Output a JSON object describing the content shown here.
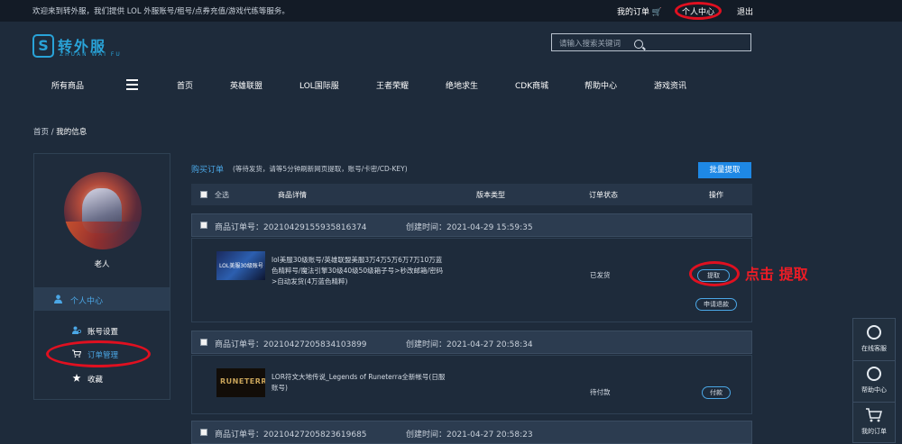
{
  "topbar": {
    "welcome": "欢迎来到转外服，我们提供 LOL 外服账号/租号/点券充值/游戏代练等服务。",
    "my_orders": "我的订单 🛒",
    "personal_center": "个人中心",
    "logout": "退出"
  },
  "logo": {
    "mark": "S",
    "name": "转外服",
    "pinyin": "ZHUAN WAI FU"
  },
  "search": {
    "placeholder": "请输入搜索关键词"
  },
  "nav": {
    "items": [
      "所有商品",
      "首页",
      "英雄联盟",
      "LOL国际服",
      "王者荣耀",
      "绝地求生",
      "CDK商城",
      "帮助中心",
      "游戏资讯"
    ]
  },
  "breadcrumb": {
    "home": "首页",
    "sep": " / ",
    "current": "我的信息"
  },
  "sidebar": {
    "username": "老人",
    "active": "个人中心",
    "links": [
      "账号设置",
      "订单管理",
      "收藏"
    ]
  },
  "orders_panel": {
    "title": "购买订单",
    "note": "(等待发货，请等5分钟刷新网页提取，账号/卡密/CD-KEY)",
    "batch_button": "批量提取",
    "headers": {
      "select_all": "全选",
      "detail": "商品详情",
      "version": "版本类型",
      "status": "订单状态",
      "action": "操作"
    }
  },
  "orders": [
    {
      "number": "商品订单号：20210429155935816374",
      "created": "创建时间：2021-04-29 15:59:35",
      "desc_lines": [
        "lol美服30级账号/英雄联盟美服3万4万5万6万7万10万蓝",
        "色精粹号/魔法引擎30级40级50级箱子号>秒改邮箱/密码",
        ">自动发货(4万蓝色精粹)"
      ],
      "thumb_text": "LOL美服30级账号",
      "status": "已发货",
      "actions": [
        "提取",
        "申请退款"
      ]
    },
    {
      "number": "商品订单号：20210427205834103899",
      "created": "创建时间：2021-04-27 20:58:34",
      "desc_lines": [
        "LOR符文大地传说_Legends of Runeterra全新帐号(日服",
        "账号)"
      ],
      "thumb_text": "RUNETERRA",
      "status": "待付款",
      "actions": [
        "付款"
      ]
    },
    {
      "number": "商品订单号：20210427205823619685",
      "created": "创建时间：2021-04-27 20:58:23"
    }
  ],
  "annotation": "点击 提取",
  "float_bar": {
    "items": [
      "在线客服",
      "帮助中心",
      "我的订单"
    ]
  },
  "colors": {
    "accent": "#4ba7e6",
    "button": "#1e88e5",
    "annotation": "#ee1c25",
    "background": "#1e2b3b"
  }
}
